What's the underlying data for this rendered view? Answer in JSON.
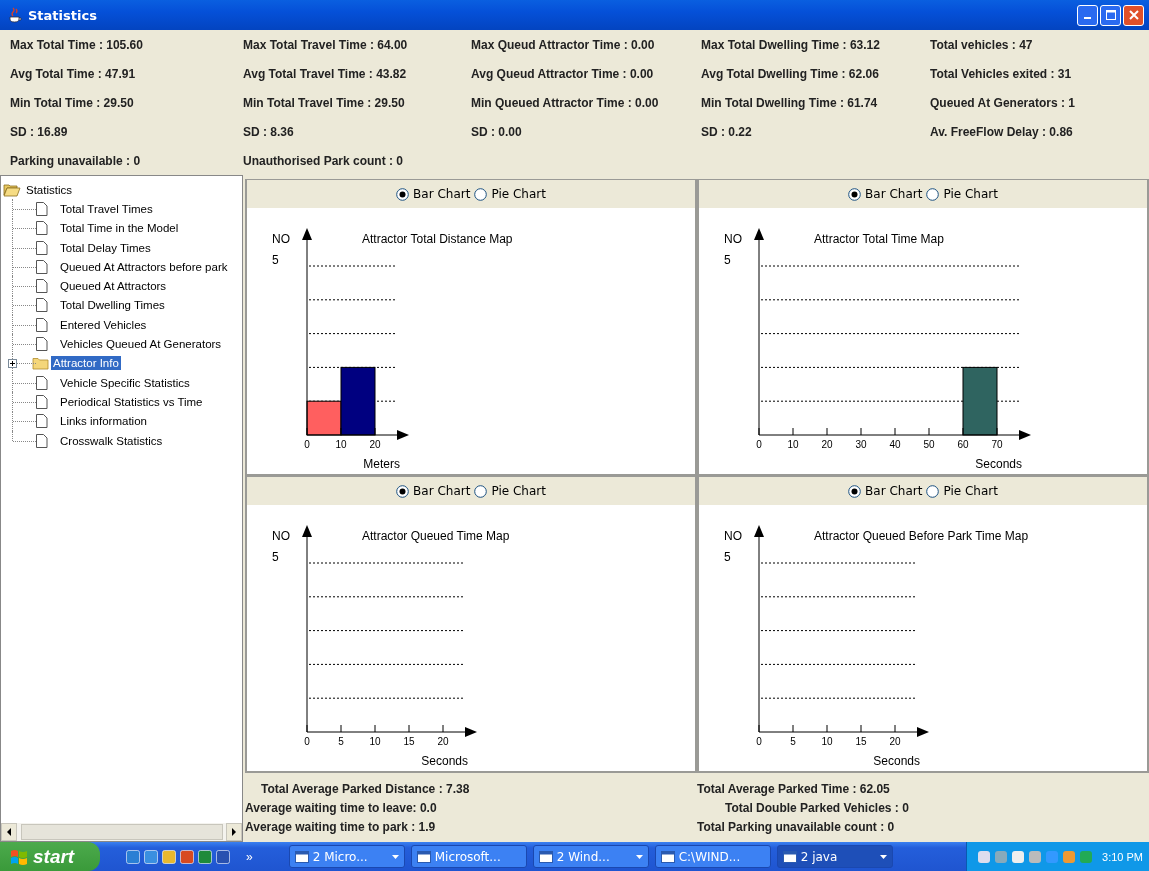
{
  "window": {
    "title": "Statistics"
  },
  "stats": {
    "rows": [
      [
        "Max Total Time : 105.60",
        "Max Total Travel Time : 64.00",
        "Max Queud Attractor Time : 0.00",
        "Max Total Dwelling Time : 63.12",
        "Total vehicles : 47"
      ],
      [
        "Avg Total Time : 47.91",
        "Avg Total Travel Time : 43.82",
        "Avg Queud Attractor Time : 0.00",
        "Avg Total Dwelling Time : 62.06",
        "Total Vehicles exited : 31"
      ],
      [
        "Min Total Time : 29.50",
        "Min Total Travel Time : 29.50",
        "Min Queued Attractor Time : 0.00",
        "Min Total Dwelling Time : 61.74",
        "Queued At Generators : 1"
      ],
      [
        "SD : 16.89",
        "SD : 8.36",
        "SD : 0.00",
        "SD : 0.22",
        "Av. FreeFlow Delay : 0.86"
      ],
      [
        "Parking unavailable : 0",
        "Unauthorised Park count : 0"
      ]
    ]
  },
  "tree": {
    "root": {
      "label": "Statistics",
      "kind": "folder",
      "expanded": true,
      "selected": false,
      "children": [
        {
          "label": "Total Travel Times",
          "kind": "leaf",
          "selected": false
        },
        {
          "label": "Total Time in the Model",
          "kind": "leaf",
          "selected": false
        },
        {
          "label": "Total Delay Times",
          "kind": "leaf",
          "selected": false
        },
        {
          "label": "Queued At Attractors before park",
          "kind": "leaf",
          "selected": false
        },
        {
          "label": "Queued At Attractors",
          "kind": "leaf",
          "selected": false
        },
        {
          "label": "Total Dwelling Times",
          "kind": "leaf",
          "selected": false
        },
        {
          "label": "Entered Vehicles",
          "kind": "leaf",
          "selected": false
        },
        {
          "label": "Vehicles Queued At Generators",
          "kind": "leaf",
          "selected": false
        },
        {
          "label": "Attractor Info",
          "kind": "folder",
          "expanded": false,
          "selected": true
        },
        {
          "label": "Vehicle Specific Statistics",
          "kind": "leaf",
          "selected": false
        },
        {
          "label": "Periodical Statistics vs Time",
          "kind": "leaf",
          "selected": false
        },
        {
          "label": "Links information",
          "kind": "leaf",
          "selected": false
        },
        {
          "label": "Crosswalk Statistics",
          "kind": "leaf",
          "selected": false
        }
      ]
    }
  },
  "charts": [
    {
      "options": [
        {
          "label": "Bar Chart",
          "selected": true
        },
        {
          "label": "Pie Chart",
          "selected": false
        }
      ],
      "y_axis_label": "NO",
      "y_top_label": "5",
      "title": "Attractor Total Distance Map",
      "x_tick_labels": [
        "0",
        "10",
        "20"
      ],
      "x_axis_label": "Meters"
    },
    {
      "options": [
        {
          "label": "Bar Chart",
          "selected": true
        },
        {
          "label": "Pie Chart",
          "selected": false
        }
      ],
      "y_axis_label": "NO",
      "y_top_label": "5",
      "title": "Attractor Total Time Map",
      "x_tick_labels": [
        "0",
        "10",
        "20",
        "30",
        "40",
        "50",
        "60",
        "70"
      ],
      "x_axis_label": "Seconds"
    },
    {
      "options": [
        {
          "label": "Bar Chart",
          "selected": true
        },
        {
          "label": "Pie Chart",
          "selected": false
        }
      ],
      "y_axis_label": "NO",
      "y_top_label": "5",
      "title": "Attractor Queued Time Map",
      "x_tick_labels": [
        "0",
        "5",
        "10",
        "15",
        "20"
      ],
      "x_axis_label": "Seconds"
    },
    {
      "options": [
        {
          "label": "Bar Chart",
          "selected": true
        },
        {
          "label": "Pie Chart",
          "selected": false
        }
      ],
      "y_axis_label": "NO",
      "y_top_label": "5",
      "title": "Attractor Queued Before Park Time Map",
      "x_tick_labels": [
        "0",
        "5",
        "10",
        "15",
        "20"
      ],
      "x_axis_label": "Seconds"
    }
  ],
  "summary": {
    "left": [
      {
        "text": "Total Average Parked Distance : 7.38",
        "indent": true
      },
      {
        "text": "Average waiting time to leave: 0.0",
        "indent": false
      },
      {
        "text": "Average waiting time to park : 1.9",
        "indent": false
      }
    ],
    "right": [
      {
        "text": "Total Average Parked Time : 62.05",
        "indent": false
      },
      {
        "text": "Total Double Parked Vehicles : 0",
        "indent": true
      },
      {
        "text": "Total Parking unavailable count : 0",
        "indent": false
      }
    ]
  },
  "taskbar": {
    "start": "start",
    "overflow": "»",
    "tasks": [
      {
        "label": "2 Micro...",
        "grouped": true,
        "selected": false
      },
      {
        "label": "Microsoft...",
        "grouped": false,
        "selected": false
      },
      {
        "label": "2 Wind...",
        "grouped": true,
        "selected": false
      },
      {
        "label": "C:\\WIND...",
        "grouped": false,
        "selected": false
      },
      {
        "label": "2 java",
        "grouped": true,
        "selected": true
      }
    ],
    "clock": "3:10 PM"
  }
}
